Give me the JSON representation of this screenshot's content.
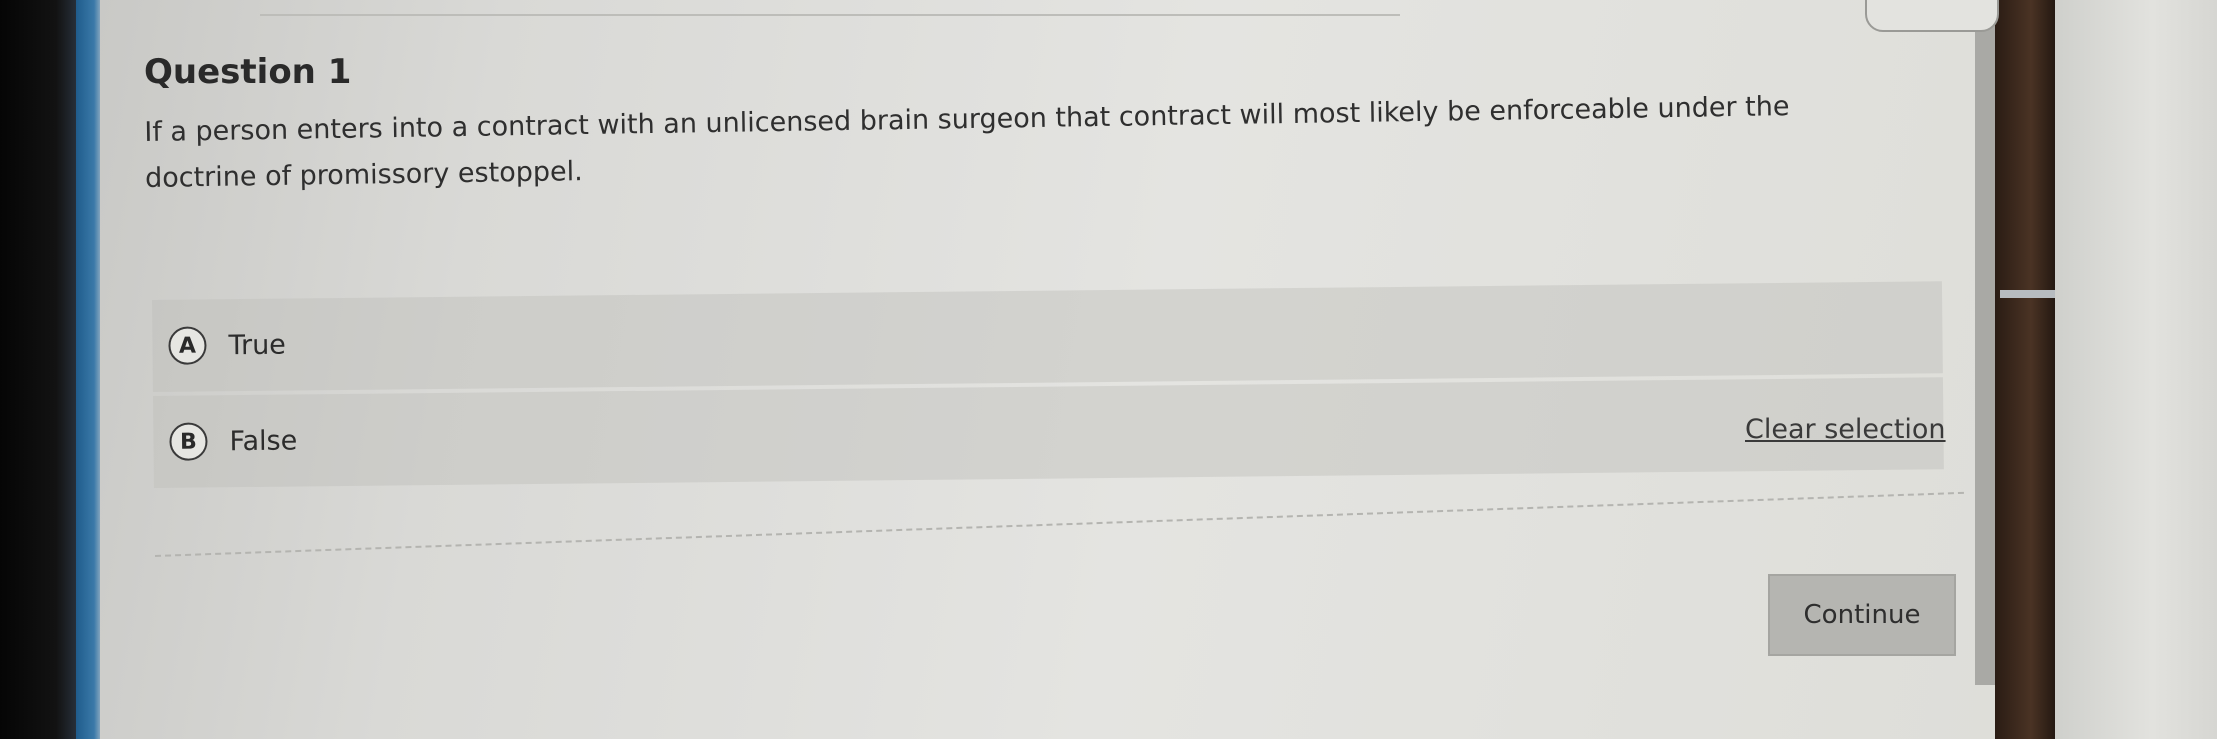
{
  "question": {
    "title": "Question 1",
    "text": "If a person enters into a contract with an unlicensed brain surgeon that contract will most likely be enforceable under the doctrine of promissory estoppel."
  },
  "answers": [
    {
      "letter": "A",
      "label": "True"
    },
    {
      "letter": "B",
      "label": "False"
    }
  ],
  "actions": {
    "clear_selection": "Clear selection",
    "continue": "Continue"
  }
}
